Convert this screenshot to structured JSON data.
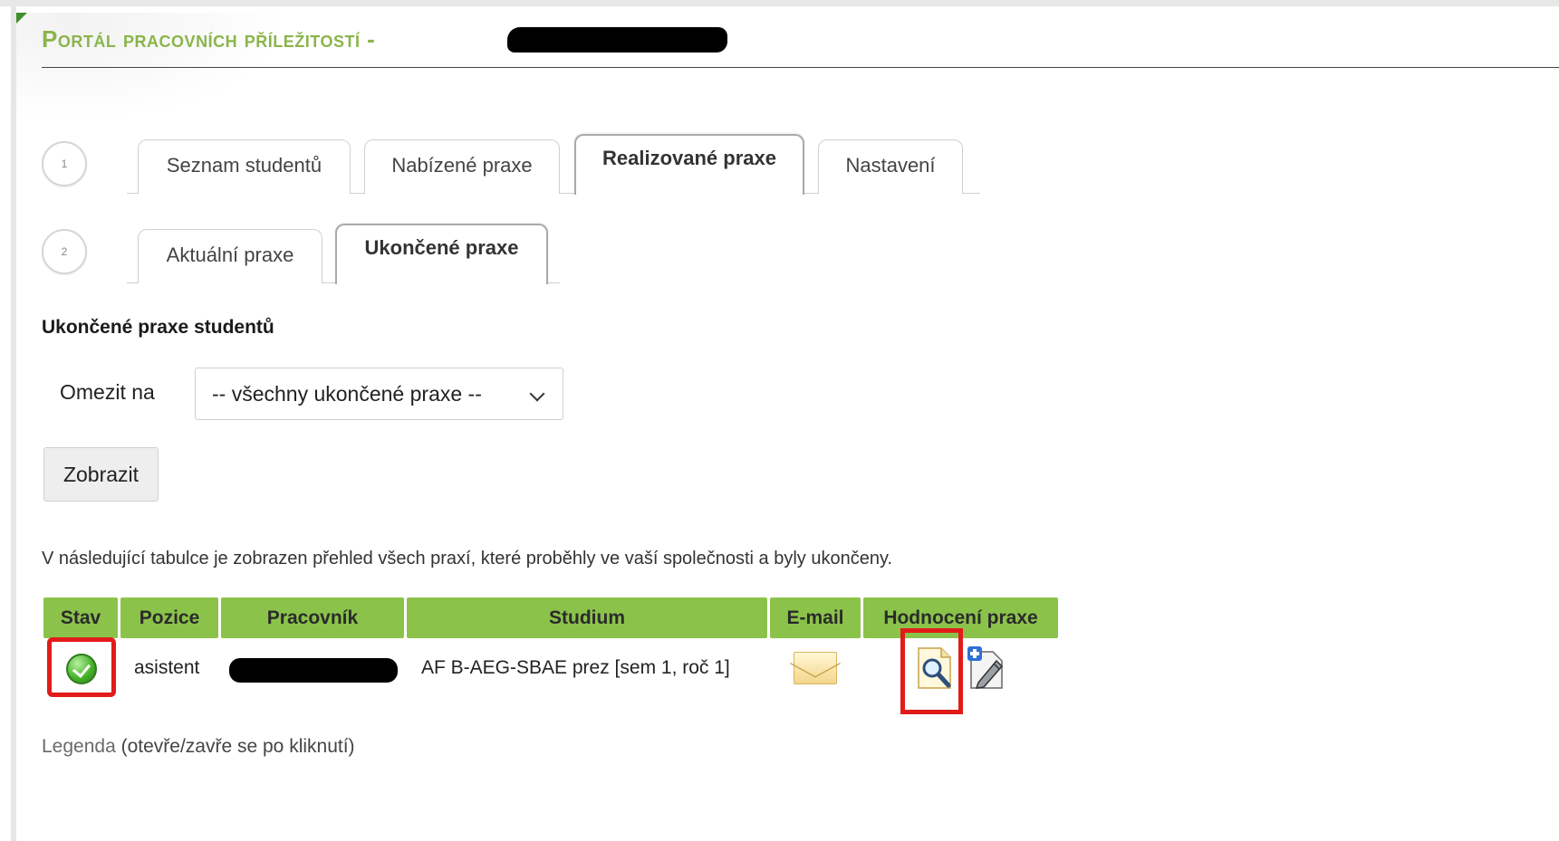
{
  "header": {
    "portal_title": "Portál pracovních příležitostí -"
  },
  "steps": {
    "step1": "1",
    "step2": "2"
  },
  "main_tabs": [
    {
      "label": "Seznam studentů",
      "active": false
    },
    {
      "label": "Nabízené praxe",
      "active": false
    },
    {
      "label": "Realizované praxe",
      "active": true
    },
    {
      "label": "Nastavení",
      "active": false
    }
  ],
  "sub_tabs": [
    {
      "label": "Aktuální praxe",
      "active": false
    },
    {
      "label": "Ukončené praxe",
      "active": true
    }
  ],
  "section": {
    "heading": "Ukončené praxe studentů"
  },
  "filter": {
    "label": "Omezit na",
    "selected": "-- všechny ukončené praxe --"
  },
  "actions": {
    "show_label": "Zobrazit"
  },
  "info": {
    "text": "V následující tabulce je zobrazen přehled všech praxí, které proběhly ve vaší společnosti a byly ukončeny."
  },
  "table": {
    "headers": [
      "Stav",
      "Pozice",
      "Pracovník",
      "Studium",
      "E-mail",
      "Hodnocení praxe"
    ],
    "rows": [
      {
        "status_icon": "check-circle-icon",
        "pozice": "asistent",
        "studium": "AF B-AEG-SBAE prez [sem 1, roč 1]",
        "email_icon": "envelope-icon",
        "eval_icons": [
          "view-evaluation-icon",
          "add-evaluation-icon"
        ]
      }
    ]
  },
  "legend": {
    "lead": "Legenda",
    "hint": "(otevře/zavře se po kliknutí)"
  },
  "colors": {
    "header_green": "#8ab54a",
    "table_header_bg": "#8bc34a",
    "highlight_red": "#e21b1b"
  }
}
